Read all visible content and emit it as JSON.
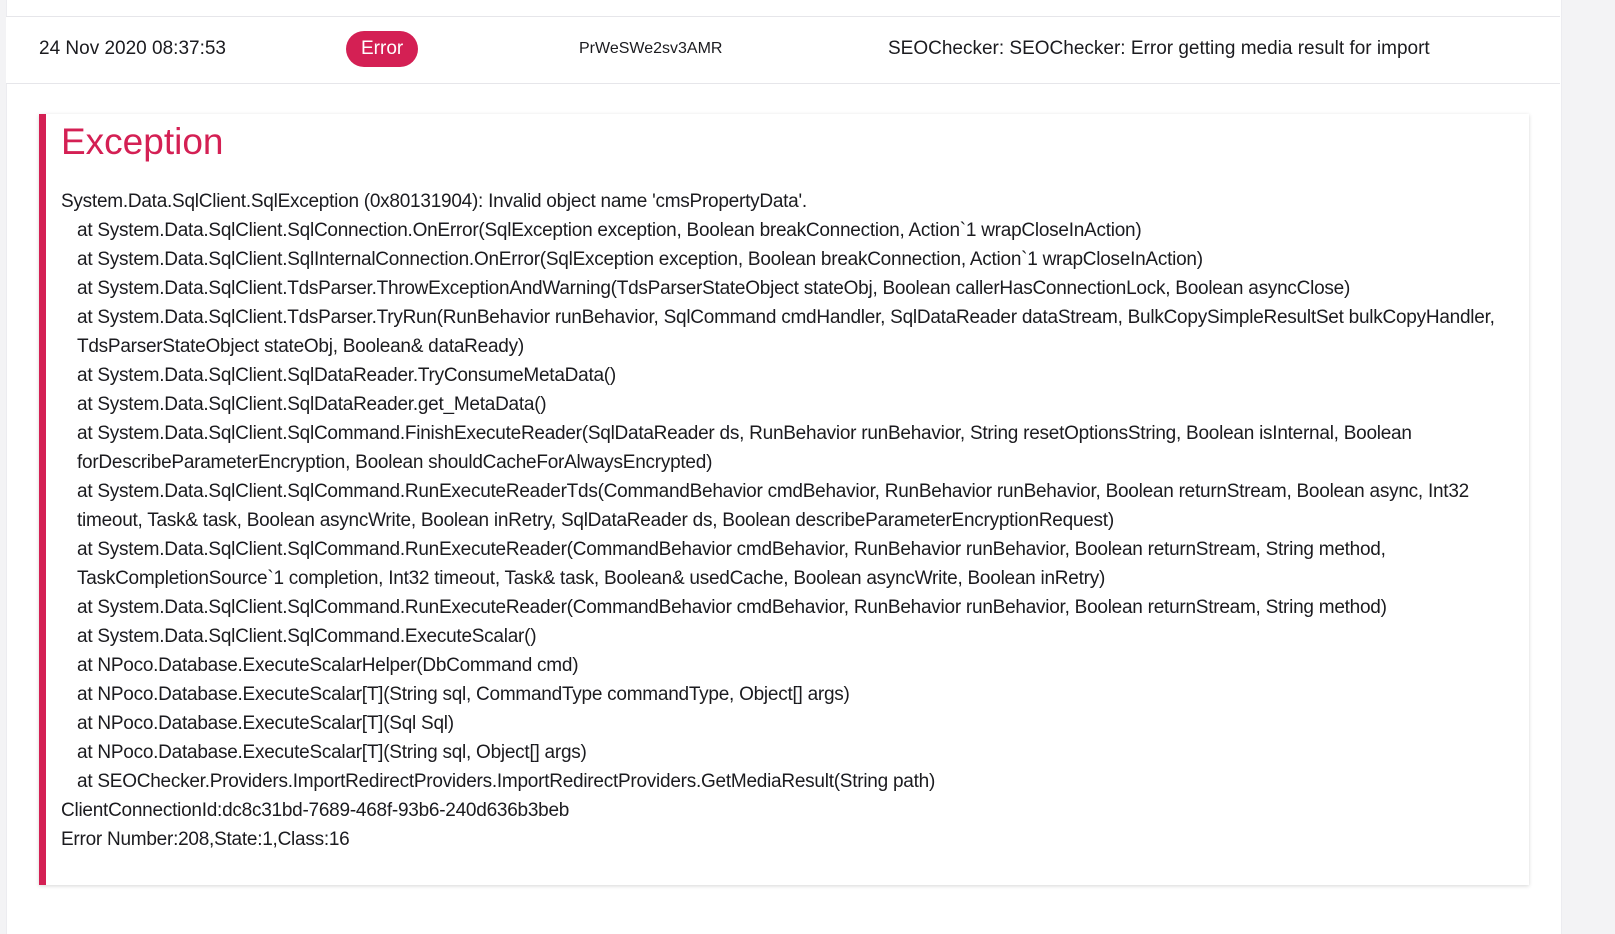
{
  "log_entry": {
    "timestamp": "24 Nov 2020 08:37:53",
    "level": "Error",
    "trace_id": "PrWeSWe2sv3AMR",
    "message": "SEOChecker: SEOChecker: Error getting media result for import"
  },
  "exception": {
    "title": "Exception",
    "lines": [
      "System.Data.SqlClient.SqlException (0x80131904): Invalid object name 'cmsPropertyData'.",
      "   at System.Data.SqlClient.SqlConnection.OnError(SqlException exception, Boolean breakConnection, Action`1 wrapCloseInAction)",
      "   at System.Data.SqlClient.SqlInternalConnection.OnError(SqlException exception, Boolean breakConnection, Action`1 wrapCloseInAction)",
      "   at System.Data.SqlClient.TdsParser.ThrowExceptionAndWarning(TdsParserStateObject stateObj, Boolean callerHasConnectionLock, Boolean asyncClose)",
      "   at System.Data.SqlClient.TdsParser.TryRun(RunBehavior runBehavior, SqlCommand cmdHandler, SqlDataReader dataStream, BulkCopySimpleResultSet bulkCopyHandler, TdsParserStateObject stateObj, Boolean& dataReady)",
      "   at System.Data.SqlClient.SqlDataReader.TryConsumeMetaData()",
      "   at System.Data.SqlClient.SqlDataReader.get_MetaData()",
      "   at System.Data.SqlClient.SqlCommand.FinishExecuteReader(SqlDataReader ds, RunBehavior runBehavior, String resetOptionsString, Boolean isInternal, Boolean forDescribeParameterEncryption, Boolean shouldCacheForAlwaysEncrypted)",
      "   at System.Data.SqlClient.SqlCommand.RunExecuteReaderTds(CommandBehavior cmdBehavior, RunBehavior runBehavior, Boolean returnStream, Boolean async, Int32 timeout, Task& task, Boolean asyncWrite, Boolean inRetry, SqlDataReader ds, Boolean describeParameterEncryptionRequest)",
      "   at System.Data.SqlClient.SqlCommand.RunExecuteReader(CommandBehavior cmdBehavior, RunBehavior runBehavior, Boolean returnStream, String method, TaskCompletionSource`1 completion, Int32 timeout, Task& task, Boolean& usedCache, Boolean asyncWrite, Boolean inRetry)",
      "   at System.Data.SqlClient.SqlCommand.RunExecuteReader(CommandBehavior cmdBehavior, RunBehavior runBehavior, Boolean returnStream, String method)",
      "   at System.Data.SqlClient.SqlCommand.ExecuteScalar()",
      "   at NPoco.Database.ExecuteScalarHelper(DbCommand cmd)",
      "   at NPoco.Database.ExecuteScalar[T](String sql, CommandType commandType, Object[] args)",
      "   at NPoco.Database.ExecuteScalar[T](Sql Sql)",
      "   at NPoco.Database.ExecuteScalar[T](String sql, Object[] args)",
      "   at SEOChecker.Providers.ImportRedirectProviders.ImportRedirectProviders.GetMediaResult(String path)",
      "ClientConnectionId:dc8c31bd-7689-468f-93b6-240d636b3beb",
      "Error Number:208,State:1,Class:16"
    ]
  },
  "colors": {
    "accent": "#d42054",
    "background": "#f3f3f5",
    "card": "#ffffff",
    "text": "#1b1b1f"
  }
}
